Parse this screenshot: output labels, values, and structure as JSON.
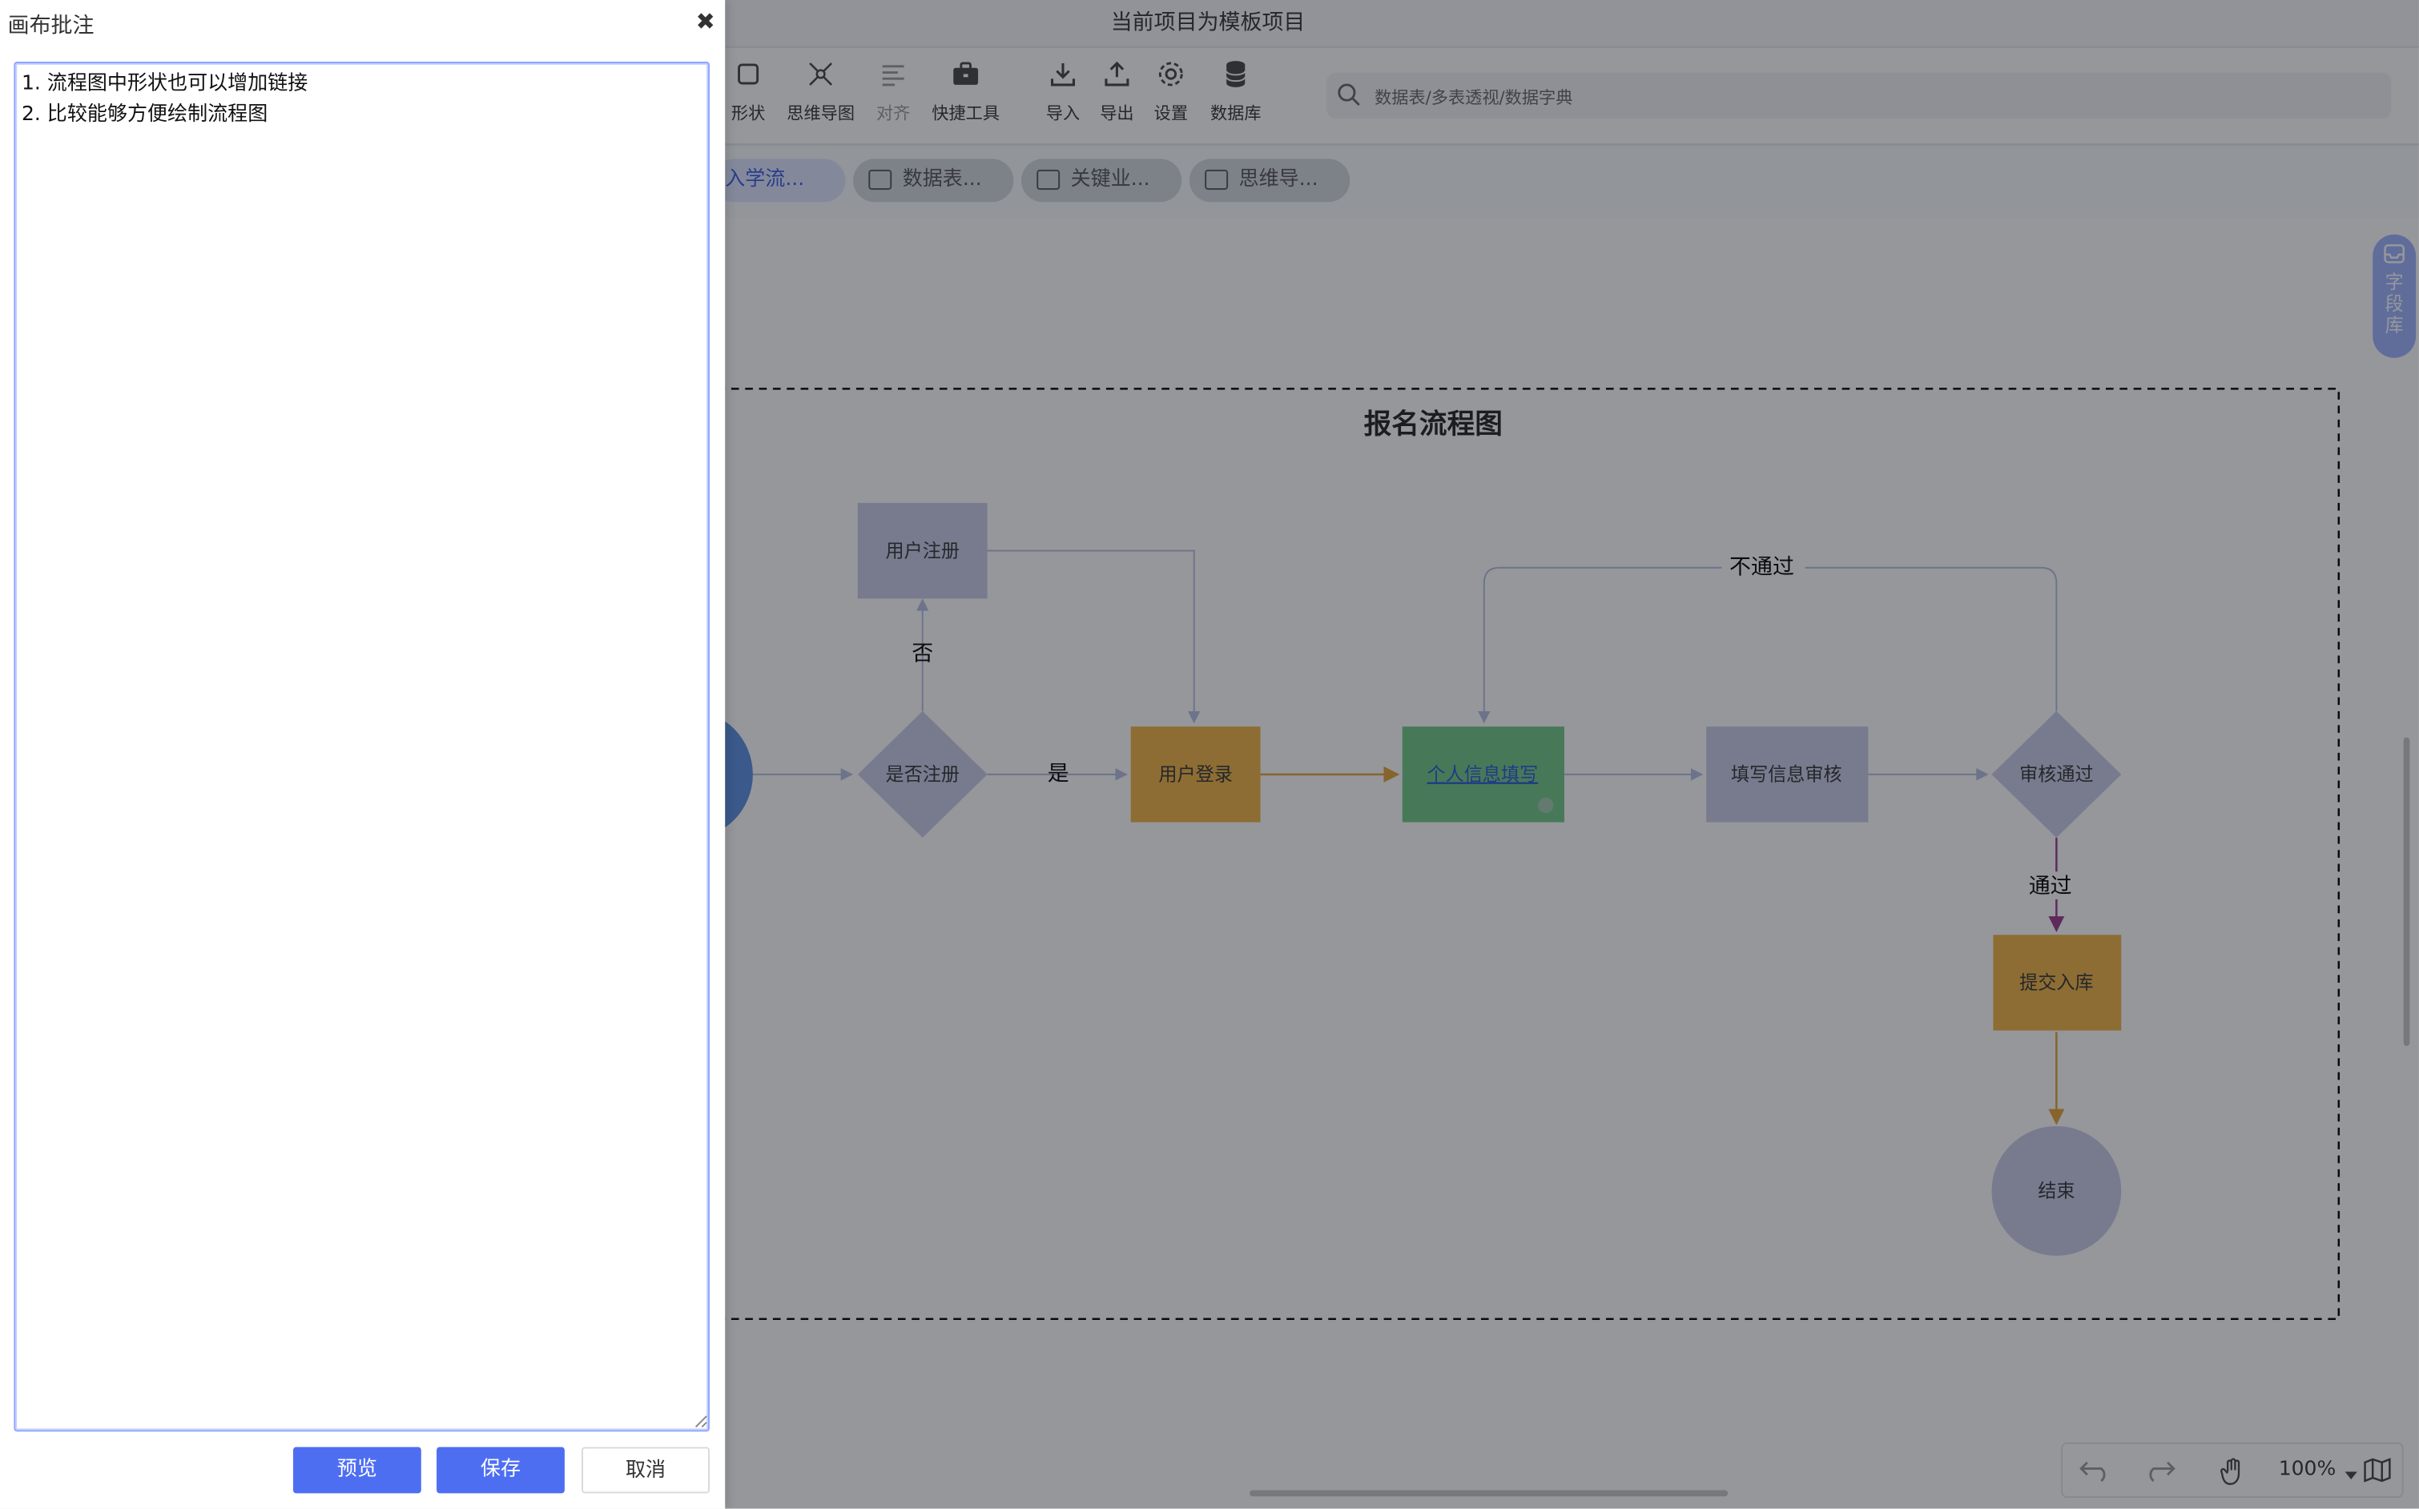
{
  "window": {
    "title": "当前项目为模板项目"
  },
  "toolbar": {
    "items": [
      {
        "label": "形状",
        "icon": "square-icon"
      },
      {
        "label": "思维导图",
        "icon": "mindmap-icon"
      },
      {
        "label": "对齐",
        "icon": "align-icon"
      },
      {
        "label": "快捷工具",
        "icon": "toolbox-icon"
      },
      {
        "label": "导入",
        "icon": "import-icon"
      },
      {
        "label": "导出",
        "icon": "export-icon"
      },
      {
        "label": "设置",
        "icon": "gear-icon"
      },
      {
        "label": "数据库",
        "icon": "database-icon"
      }
    ],
    "search_placeholder": "数据表/多表透视/数据字典"
  },
  "tabs": [
    {
      "label": "入学流...",
      "active": true
    },
    {
      "label": "数据表..."
    },
    {
      "label": "关键业..."
    },
    {
      "label": "思维导..."
    }
  ],
  "field_library": "字段库",
  "flowchart": {
    "title": "报名流程图",
    "nodes": {
      "register": "用户注册",
      "is_registered": "是否注册",
      "login": "用户登录",
      "info_fill": "个人信息填写",
      "info_review": "填写信息审核",
      "review_pass": "审核通过",
      "submit": "提交入库",
      "end": "结束"
    },
    "edge_labels": {
      "no": "否",
      "yes": "是",
      "not_pass": "不通过",
      "pass": "通过"
    }
  },
  "bottom": {
    "zoom": "100%"
  },
  "panel": {
    "title": "画布批注",
    "notes": "1. 流程图中形状也可以增加链接\n2. 比较能够方便绘制流程图",
    "preview": "预览",
    "save": "保存",
    "cancel": "取消"
  },
  "colors": {
    "accent": "#4e6ef2",
    "node_gray": "#c8cde6",
    "node_orange": "#f0b343",
    "node_green": "#71c987",
    "start_blue": "#5b8fe0"
  }
}
